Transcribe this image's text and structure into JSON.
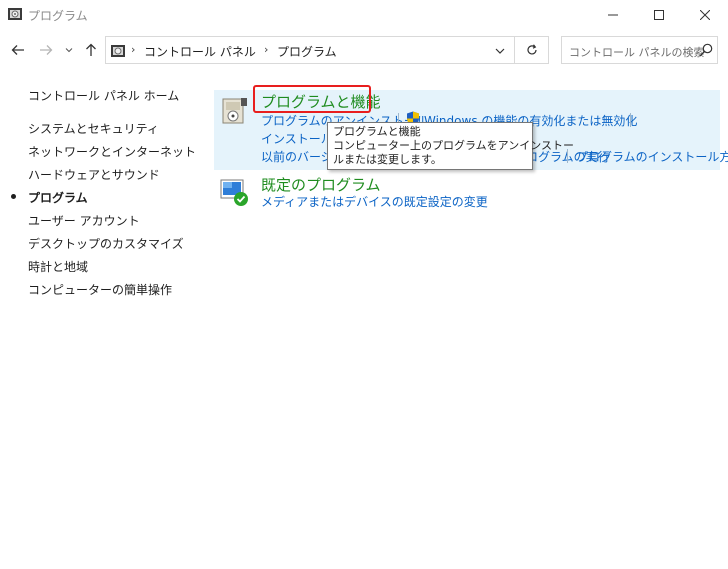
{
  "window": {
    "title": "プログラム",
    "minimize_icon": "minimize-icon",
    "maximize_icon": "maximize-icon",
    "close_icon": "close-icon"
  },
  "nav": {
    "back_icon": "arrow-left-icon",
    "forward_icon": "arrow-right-icon",
    "recent_icon": "chevron-down-icon",
    "up_icon": "arrow-up-icon"
  },
  "address": {
    "breadcrumbs": [
      "コントロール パネル",
      "プログラム"
    ],
    "separator": "›",
    "dropdown_icon": "chevron-down-icon",
    "refresh_icon": "refresh-icon"
  },
  "search": {
    "placeholder": "コントロール パネルの検索",
    "icon": "search-icon"
  },
  "sidebar": {
    "items": [
      {
        "label": "コントロール パネル ホーム"
      },
      {
        "label": "システムとセキュリティ"
      },
      {
        "label": "ネットワークとインターネット"
      },
      {
        "label": "ハードウェアとサウンド"
      },
      {
        "label": "プログラム",
        "current": true
      },
      {
        "label": "ユーザー アカウント"
      },
      {
        "label": "デスクトップのカスタマイズ"
      },
      {
        "label": "時計と地域"
      },
      {
        "label": "コンピューターの簡単操作"
      }
    ]
  },
  "main": {
    "categories": [
      {
        "title": "プログラムと機能",
        "icon": "programs-features-icon",
        "links": [
          "プログラムのアンインストール",
          "Windows の機能の有効化または無効化",
          "インストールされた更新プログラムを表示",
          "以前のバージョンの Windows 用に作成されたプログラムの実行",
          "プログラムのインストール方法"
        ]
      },
      {
        "title": "既定のプログラム",
        "icon": "default-programs-icon",
        "links": [
          "メディアまたはデバイスの既定設定の変更"
        ]
      }
    ],
    "shield_icon": "uac-shield-icon",
    "accent_green": "#1f8c1f",
    "link_blue": "#0b63c5",
    "highlight_bg": "#e5f3fb"
  },
  "tooltip": {
    "title": "プログラムと機能",
    "line1": "コンピューター上のプログラムをアンインストー",
    "line2": "ルまたは変更します。"
  }
}
